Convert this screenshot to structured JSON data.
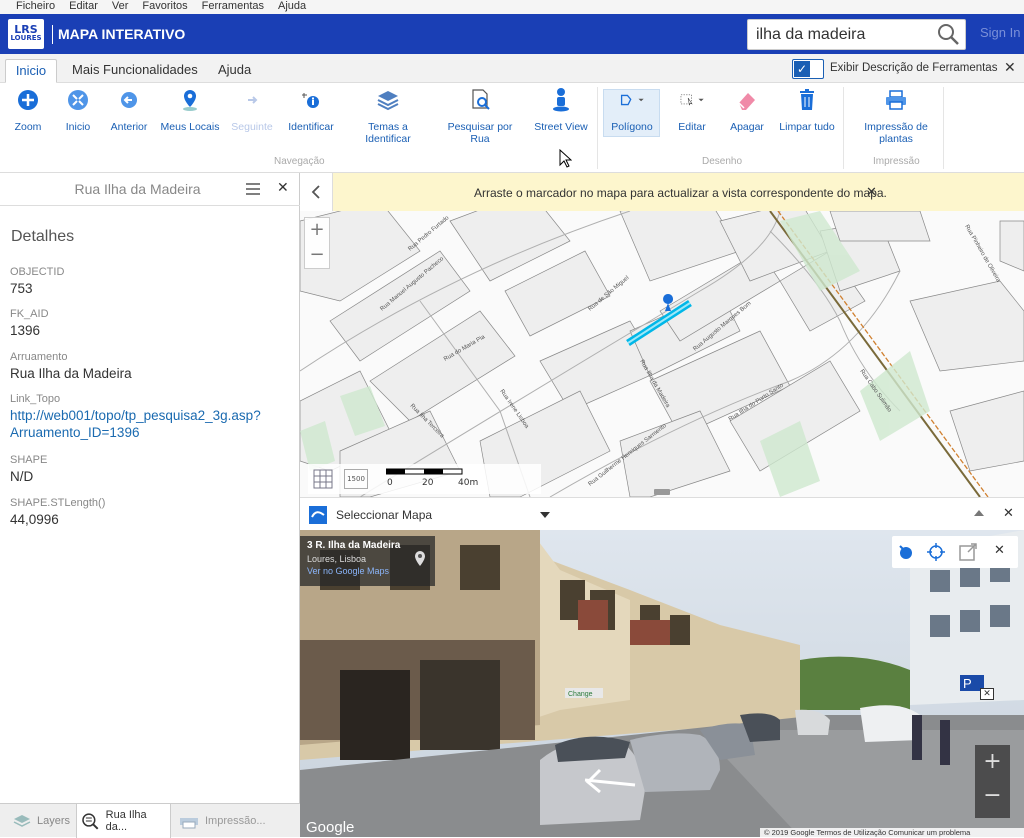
{
  "menu": [
    "Ficheiro",
    "Editar",
    "Ver",
    "Favoritos",
    "Ferramentas",
    "Ajuda"
  ],
  "app": {
    "logo_top": "LRS",
    "logo_bottom": "LOURES",
    "title": "MAPA INTERATIVO",
    "search_value": "ilha da madeira",
    "signin": "Sign In"
  },
  "tabs": {
    "t1": "Inicio",
    "t2": "Mais Funcionalidades",
    "t3": "Ajuda",
    "toggle_label": "Exibir Descrição de Ferramentas"
  },
  "ribbon": {
    "zoom": "Zoom",
    "inicio": "Inicio",
    "anterior": "Anterior",
    "meus_locais": "Meus Locais",
    "seguinte": "Seguinte",
    "identificar": "Identificar",
    "temas_1": "Temas a",
    "temas_2": "Identificar",
    "pesquisar_1": "Pesquisar por",
    "pesquisar_2": "Rua",
    "street_view": "Street View",
    "poligono": "Polígono",
    "editar": "Editar",
    "apagar": "Apagar",
    "limpar": "Limpar tudo",
    "impressao_1": "Impressão de",
    "impressao_2": "plantas",
    "grp_nav": "Navegação",
    "grp_desenho": "Desenho",
    "grp_impressao": "Impressão"
  },
  "left": {
    "title": "Rua Ilha da Madeira",
    "heading": "Detalhes",
    "f1k": "OBJECTID",
    "f1v": "753",
    "f2k": "FK_AID",
    "f2v": "1396",
    "f3k": "Arruamento",
    "f3v": "Rua Ilha da Madeira",
    "f4k": "Link_Topo",
    "f4v1": "http://web001/topo/tp_pesquisa2_3g.asp?",
    "f4v2": "Arruamento_ID=1396",
    "f5k": "SHAPE",
    "f5v": "N/D",
    "f6k": "SHAPE.STLength()",
    "f6v": "44,0996"
  },
  "bottom_tabs": {
    "layers": "Layers",
    "rua": "Rua Ilha da...",
    "impressao": "Impressão..."
  },
  "notice": "Arraste o marcador no mapa para actualizar a vista correspondente do mapa.",
  "map": {
    "scale_0": "0",
    "scale_20": "20",
    "scale_40": "40m",
    "scale_badge": "1500",
    "streets": [
      "Rua Manuel Augusto Pacheco",
      "Rua Pedro Furtado",
      "Rua de São Miguel",
      "Rua Augusto Marques Bom",
      "Rua Ilha do Porto Santo",
      "Rua Ilha da Madeira",
      "Rua Guilherme Henriques Sarmento",
      "Rua Ilha Terceira",
      "Rua Irene Lisboa",
      "Rua do Maria Pia",
      "Rua Cabo Sulimão",
      "Rua Pinheiro de Oliveira"
    ]
  },
  "selmap": {
    "label": "Seleccionar Mapa"
  },
  "streetview": {
    "addr": "3 R. Ilha da Madeira",
    "place": "Loures, Lisboa",
    "gmaps": "Ver no Google Maps",
    "google": "Google",
    "shop": "Change",
    "copyright": "© 2019 Google    Termos de Utilização    Comunicar um problema"
  }
}
